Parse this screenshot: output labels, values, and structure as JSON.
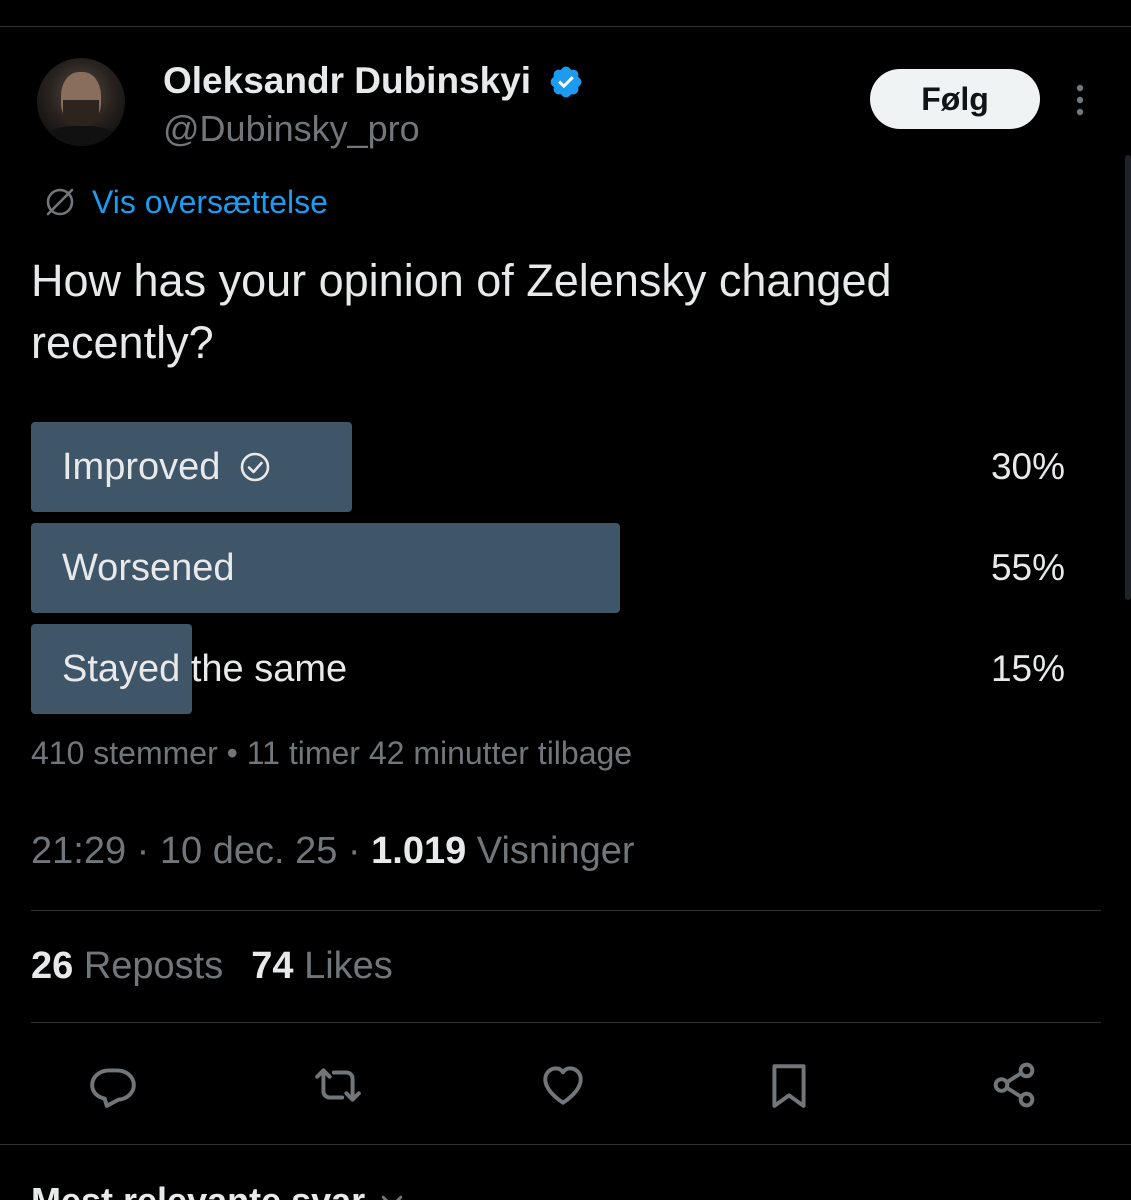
{
  "author": {
    "display_name": "Oleksandr Dubinskyi",
    "handle": "@Dubinsky_pro",
    "verified": true
  },
  "follow_label": "Følg",
  "translate_label": "Vis oversættelse",
  "post": {
    "question": "How has your opinion of Zelensky changed recently?"
  },
  "poll": {
    "options": [
      {
        "label": "Improved",
        "percent_text": "30%",
        "fraction": 0.3,
        "selected": true
      },
      {
        "label": "Worsened",
        "percent_text": "55%",
        "fraction": 0.55,
        "selected": false
      },
      {
        "label": "Stayed the same",
        "percent_text": "15%",
        "fraction": 0.15,
        "selected": false
      }
    ],
    "meta": "410 stemmer • 11 timer 42 minutter tilbage"
  },
  "timestamp": {
    "time": "21:29",
    "sep1": " · ",
    "date": "10 dec. 25",
    "sep2": " · ",
    "views_count": "1.019",
    "views_label": " Visninger"
  },
  "stats": {
    "reposts_count": "26",
    "reposts_label": " Reposts",
    "likes_count": "74",
    "likes_label": " Likes"
  },
  "actions": [
    "reply-icon",
    "repost-icon",
    "like-icon",
    "bookmark-icon",
    "share-icon"
  ],
  "sort_label": "Mest relevante svar",
  "colors": {
    "background": "#000000",
    "text": "#e7e9ea",
    "muted": "#71767b",
    "accent": "#1d9bf0",
    "poll_bar": "#3f5568",
    "divider": "#2f3336"
  }
}
